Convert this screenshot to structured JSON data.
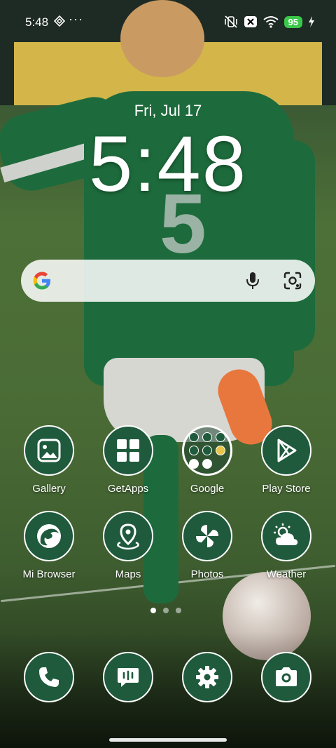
{
  "status_bar": {
    "time": "5:48",
    "more": "···",
    "battery": "95",
    "icons": [
      "diamond-icon",
      "mute-vibrate-icon",
      "x-box-icon",
      "wifi-icon",
      "battery-icon",
      "charging-icon"
    ]
  },
  "lockscreen_widget": {
    "date": "Fri, Jul 17",
    "time": "5:48"
  },
  "search_bar": {
    "icons": [
      "google-g-icon",
      "mic-icon",
      "lens-icon"
    ]
  },
  "apps_row1": [
    {
      "label": "Gallery",
      "icon": "gallery-icon"
    },
    {
      "label": "GetApps",
      "icon": "grid-icon"
    },
    {
      "label": "Google",
      "icon": "folder-icon"
    },
    {
      "label": "Play Store",
      "icon": "play-icon"
    }
  ],
  "apps_row2": [
    {
      "label": "Mi Browser",
      "icon": "browser-icon"
    },
    {
      "label": "Maps",
      "icon": "map-pin-icon"
    },
    {
      "label": "Photos",
      "icon": "pinwheel-icon"
    },
    {
      "label": "Weather",
      "icon": "weather-icon"
    }
  ],
  "page_indicator": {
    "count": 3,
    "active": 1
  },
  "dock": [
    {
      "icon": "phone-icon"
    },
    {
      "icon": "messages-icon"
    },
    {
      "icon": "settings-icon"
    },
    {
      "icon": "camera-icon"
    }
  ],
  "colors": {
    "icon_bg": "#1f5a3d",
    "battery": "#3bc84a"
  }
}
